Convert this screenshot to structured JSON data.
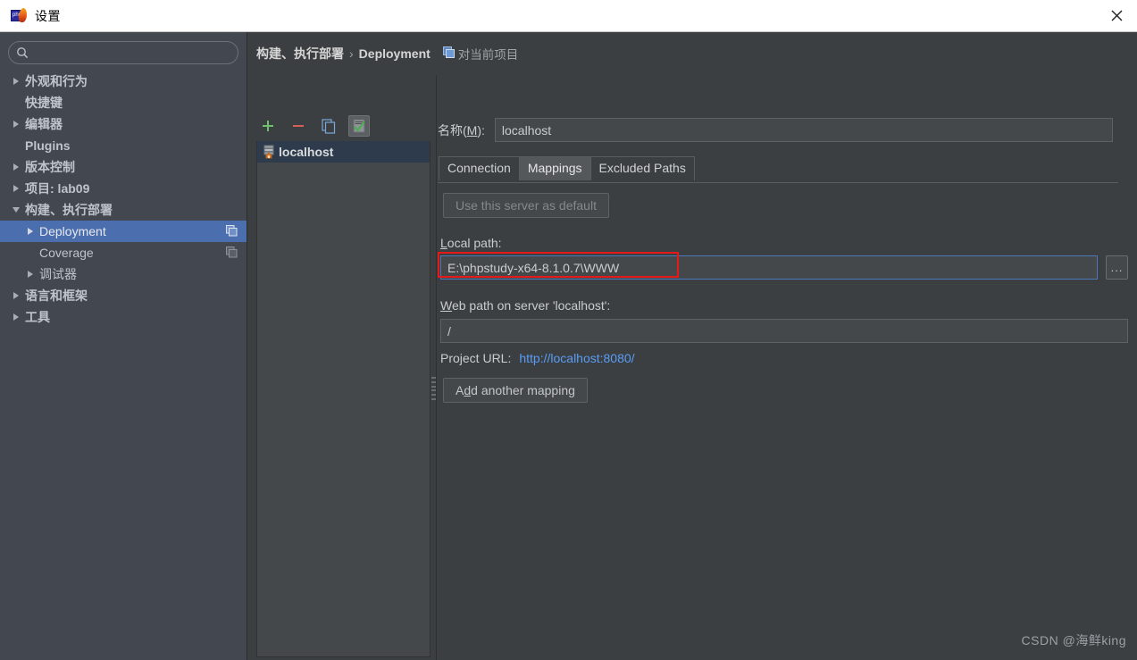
{
  "window": {
    "title": "设置",
    "app_icon": "phpstorm-icon",
    "close_label": "×"
  },
  "sidebar": {
    "search": {
      "value": "",
      "placeholder": "",
      "icon": "search-icon"
    },
    "items": [
      {
        "label": "外观和行为",
        "arrow": "right",
        "indent": 0,
        "bold": true,
        "selected": false,
        "badge": false
      },
      {
        "label": "快捷键",
        "arrow": "none",
        "indent": 0,
        "bold": true,
        "selected": false,
        "badge": false
      },
      {
        "label": "编辑器",
        "arrow": "right",
        "indent": 0,
        "bold": true,
        "selected": false,
        "badge": false
      },
      {
        "label": "Plugins",
        "arrow": "none",
        "indent": 0,
        "bold": true,
        "selected": false,
        "badge": false
      },
      {
        "label": "版本控制",
        "arrow": "right",
        "indent": 0,
        "bold": true,
        "selected": false,
        "badge": false
      },
      {
        "label": "项目: lab09",
        "arrow": "right",
        "indent": 0,
        "bold": true,
        "selected": false,
        "badge": false
      },
      {
        "label": "构建、执行部署",
        "arrow": "down",
        "indent": 0,
        "bold": true,
        "selected": false,
        "badge": false
      },
      {
        "label": "Deployment",
        "arrow": "right",
        "indent": 1,
        "bold": false,
        "selected": true,
        "badge": true
      },
      {
        "label": "Coverage",
        "arrow": "none",
        "indent": 1,
        "bold": false,
        "selected": false,
        "badge": true
      },
      {
        "label": "调试器",
        "arrow": "right",
        "indent": 1,
        "bold": false,
        "selected": false,
        "badge": false
      },
      {
        "label": "语言和框架",
        "arrow": "right",
        "indent": 0,
        "bold": true,
        "selected": false,
        "badge": false
      },
      {
        "label": "工具",
        "arrow": "right",
        "indent": 0,
        "bold": true,
        "selected": false,
        "badge": false
      }
    ]
  },
  "breadcrumb": {
    "root": "构建、执行部署",
    "separator": "›",
    "current": "Deployment",
    "scope": "对当前项目",
    "scope_icon": "copy-icon"
  },
  "host_toolbar": {
    "add_label": "+",
    "remove_label": "−",
    "copy_label": "copy-icon",
    "default_label": "set-default-icon"
  },
  "host_list": {
    "items": [
      {
        "label": "localhost",
        "icon": "server-icon",
        "selected": true
      }
    ]
  },
  "form": {
    "name_label": "名称(M):",
    "name_mnemonic": "M",
    "name_value": "localhost",
    "tabs": [
      {
        "label": "Connection",
        "active": false
      },
      {
        "label": "Mappings",
        "active": true
      },
      {
        "label": "Excluded Paths",
        "active": false
      }
    ],
    "use_default_button": "Use this server as default",
    "use_default_disabled": true,
    "local_path_label": "Local path:",
    "local_path_mnemonic": "L",
    "local_path_value": "E:\\phpstudy-x64-8.1.0.7\\WWW",
    "browse_button": "...",
    "web_path_label": "Web path on server 'localhost':",
    "web_path_mnemonic": "W",
    "web_path_value": "/",
    "project_url_label": "Project URL:",
    "project_url_value": "http://localhost:8080/",
    "add_mapping_button": "Add another mapping",
    "add_mapping_mnemonic": "d"
  },
  "highlight": {
    "color": "#e61919",
    "target": "local-path-field"
  },
  "watermark": "CSDN @海鲜king",
  "colors": {
    "accent_selection": "#4b6eaf",
    "link": "#589df6",
    "panel_bg": "#3c3f41",
    "sidebar_bg": "#434750",
    "field_bg": "#45484a",
    "focus_border": "#4a78b8",
    "highlight_red": "#e61919"
  }
}
